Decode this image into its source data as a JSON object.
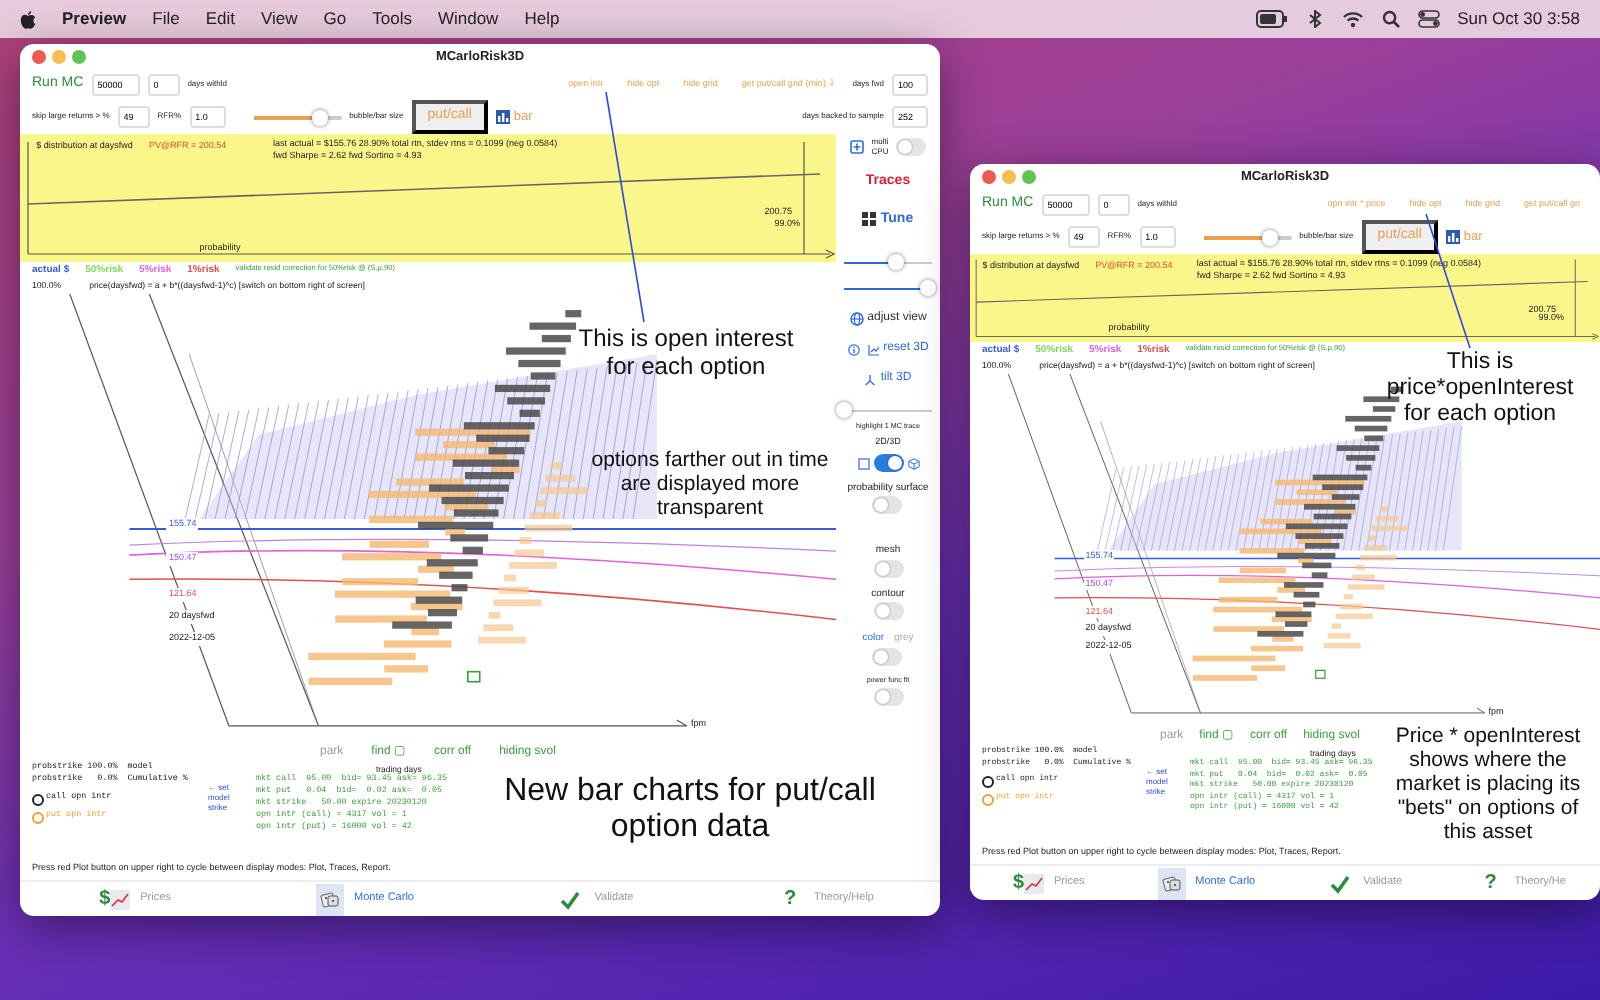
{
  "menu_bar": {
    "app": "Preview",
    "items": [
      "File",
      "Edit",
      "View",
      "Go",
      "Tools",
      "Window",
      "Help"
    ],
    "clock": "Sun Oct 30  3:58"
  },
  "windows": [
    {
      "title": "MCarloRisk3D",
      "toolbar": {
        "run": "Run MC",
        "runs": "50000",
        "withheld": "0",
        "withheld_label": "days withld",
        "links": [
          "open intr",
          "hide opt",
          "hide grid",
          "get put/call grid (min) ⇩"
        ],
        "fwd_label": "days fwd",
        "fwd": "100"
      },
      "options": {
        "skip_label": "skip large returns > %",
        "skip": "49",
        "rfr_label": "RFR%",
        "rfr": "1.0",
        "size": {
          "level": 0.75
        },
        "size_label": "bubble/bar size",
        "putcall": "put/call",
        "bar": "bar",
        "backtest_label": "days backed to sample",
        "backtest": "252"
      },
      "panel": {
        "title": "$ distribution at daysfwd",
        "pv": "PV@RFR = 200.54",
        "stats": [
          "last actual = $155.76  28.90% total rtn, stdev rtns = 0.1099 (neg 0.0584)",
          "fwd Sharpe = 2.62 fwd Sortino = 4.93"
        ],
        "value": "200.75",
        "percent": "99.0%",
        "xlabel": "probability"
      },
      "legend": {
        "items": [
          {
            "label": "actual $",
            "color": "#3a5bd9"
          },
          {
            "label": "50%risk",
            "color": "#7ed957"
          },
          {
            "label": "5%risk",
            "color": "#e060e0"
          },
          {
            "label": "1%risk",
            "color": "#e05050"
          }
        ],
        "note": "validate resid correction for 50%risk @ (S,μ,90)",
        "percent": "100.0%",
        "formula": "price(daysfwd) = a + b*((daysfwd-1)^c) [switch on bottom right of screen]"
      },
      "plot": {
        "labels": [
          "155.74",
          "150.47",
          "121.64",
          "20 daysfwd",
          "2022-12-05"
        ],
        "axis": "fpm"
      },
      "annotations": [
        "This is open interest for each option",
        "options farther out in time are displayed more transparent",
        "New bar charts for put/call option data"
      ],
      "controls": [
        {
          "label": "park",
          "disabled": true
        },
        {
          "label": "find ▢",
          "disabled": false
        },
        {
          "label": "corr off",
          "disabled": false
        },
        {
          "label": "hiding svol",
          "disabled": false
        }
      ],
      "probstrike": [
        "probstrike 100.0%  model",
        "probstrike   0.0%  Cumulative %"
      ],
      "trading_days": "trading days",
      "open_interest_keys": [
        {
          "label": "call opn intr",
          "color": "#222222"
        },
        {
          "label": "put opn intr",
          "color": "#f0a030"
        }
      ],
      "set_buttons": [
        "← set",
        "model",
        "strike"
      ],
      "market": [
        "mkt call  95.00  bid= 93.45 ask= 96.35",
        "mkt put   0.04  bid=  0.02 ask=  0.05",
        "mkt strike   50.00 expire 20230120",
        "opn intr (call) = 4317 vol = 1",
        "opn intr (put) = 16000 vol = 42"
      ],
      "hint": "Press red Plot button on upper right to cycle between display modes:  Plot, Traces, Report.",
      "tabs": [
        {
          "kind": "prices",
          "glyph": "$",
          "label": "Prices",
          "selected": false
        },
        {
          "kind": "dice",
          "label": "Monte Carlo",
          "selected": true
        },
        {
          "kind": "check",
          "label": "Validate",
          "selected": false
        },
        {
          "kind": "help",
          "glyph": "?",
          "label": "Theory/Help",
          "selected": false
        }
      ],
      "sidebar": {
        "multi_cpu": {
          "label": "multi CPU",
          "on": false
        },
        "plot_mode": "Traces",
        "tune": "Tune",
        "view_sliders": [
          {
            "level": 0.6
          },
          {
            "level": 0.95
          }
        ],
        "adjust_view": "adjust view",
        "reset": "reset 3D",
        "tilt": "tilt 3D",
        "highlight": {
          "label": "highlight 1 MC trace",
          "level": 0.0
        },
        "dimension": {
          "label": "2D/3D",
          "on": true
        },
        "switches": [
          {
            "label": "probability surface",
            "on": false
          },
          {
            "label": "mesh",
            "on": false
          },
          {
            "label": "contour",
            "on": false
          },
          {
            "options": [
              {
                "label": "color",
                "selected": true
              },
              {
                "label": "grey",
                "selected": false
              }
            ],
            "on": false
          },
          {
            "label": "power func fit",
            "on": false
          }
        ]
      }
    },
    {
      "title": "MCarloRisk3D",
      "toolbar": {
        "run": "Run MC",
        "runs": "50000",
        "withheld": "0",
        "withheld_label": "days withld",
        "links": [
          "opn intr * price",
          "hide opt",
          "hide grid",
          "get put/call gri"
        ]
      },
      "options": {
        "skip_label": "skip large returns > %",
        "skip": "49",
        "rfr_label": "RFR%",
        "rfr": "1.0",
        "size": {
          "level": 0.75
        },
        "size_label": "bubble/bar size",
        "putcall": "put/call",
        "bar": "bar"
      },
      "panel": {
        "title": "$ distribution at daysfwd",
        "pv": "PV@RFR = 200.54",
        "stats": [
          "last actual = $155.76  28.90% total rtn, stdev rtns = 0.1099 (neg 0.0584)",
          "fwd Sharpe = 2.62 fwd Sortino = 4.93"
        ],
        "value": "200.75",
        "percent": "99.0%",
        "xlabel": "probability"
      },
      "legend": {
        "items": [
          {
            "label": "actual $",
            "color": "#3a5bd9"
          },
          {
            "label": "50%risk",
            "color": "#7ed957"
          },
          {
            "label": "5%risk",
            "color": "#e060e0"
          },
          {
            "label": "1%risk",
            "color": "#e05050"
          }
        ],
        "note": "validate resid correction for 50%risk @ (S,μ,90)",
        "percent": "100.0%",
        "formula": "price(daysfwd) = a + b*((daysfwd-1)^c) [switch on bottom right of screen]"
      },
      "plot": {
        "labels": [
          "155.74",
          "150.47",
          "121.64",
          "20 daysfwd",
          "2022-12-05"
        ],
        "axis": "fpm"
      },
      "annotations": [
        "This is price*openInterest for each option",
        "Price * openInterest shows where the market is placing its \"bets\" on options of this asset"
      ],
      "controls": [
        {
          "label": "park",
          "disabled": true
        },
        {
          "label": "find ▢",
          "disabled": false
        },
        {
          "label": "corr off",
          "disabled": false
        },
        {
          "label": "hiding svol",
          "disabled": false
        }
      ],
      "probstrike": [
        "probstrike 100.0%  model",
        "probstrike   0.0%  Cumulative %"
      ],
      "trading_days": "trading days",
      "open_interest_keys": [
        {
          "label": "call opn intr",
          "color": "#222222"
        },
        {
          "label": "put opn intr",
          "color": "#f0a030"
        }
      ],
      "set_buttons": [
        "← set",
        "model",
        "strike"
      ],
      "market": [
        "mkt call  95.00  bid= 93.45 ask= 96.35",
        "mkt put   0.04  bid=  0.02 ask=  0.05",
        "mkt strike   50.00 expire 20230120",
        "opn intr (call) = 4317 vol = 1",
        "opn intr (put) = 16000 vol = 42"
      ],
      "hint": "Press red Plot button on upper right to cycle between display modes:  Plot, Traces, Report.",
      "tabs": [
        {
          "kind": "prices",
          "glyph": "$",
          "label": "Prices",
          "selected": false
        },
        {
          "kind": "dice",
          "label": "Monte Carlo",
          "selected": true
        },
        {
          "kind": "check",
          "label": "Validate",
          "selected": false
        },
        {
          "kind": "help",
          "glyph": "?",
          "label": "Theory/He",
          "selected": false
        }
      ]
    }
  ]
}
